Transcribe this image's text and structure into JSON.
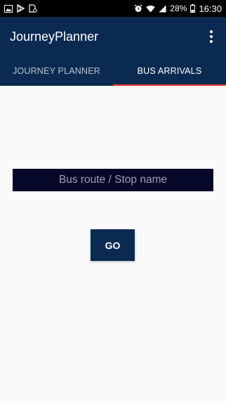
{
  "status_bar": {
    "left_icons": [
      "image-icon",
      "play-store-icon",
      "sim-toolkit-icon"
    ],
    "right_icons": [
      "alarm-icon",
      "wifi-icon",
      "signal-icon",
      "battery-icon"
    ],
    "battery": "28%",
    "time": "16:30"
  },
  "app_bar": {
    "title": "JourneyPlanner",
    "overflow_icon": "more-vert-icon"
  },
  "tabs": [
    {
      "label": "JOURNEY PLANNER",
      "active": false
    },
    {
      "label": "BUS ARRIVALS",
      "active": true
    }
  ],
  "search": {
    "placeholder": "Bus route / Stop name",
    "value": ""
  },
  "go_button": {
    "label": "GO"
  },
  "colors": {
    "primary": "#0b2a52",
    "accent": "#e53935",
    "input_bg": "#060829",
    "background": "#fafafa"
  }
}
